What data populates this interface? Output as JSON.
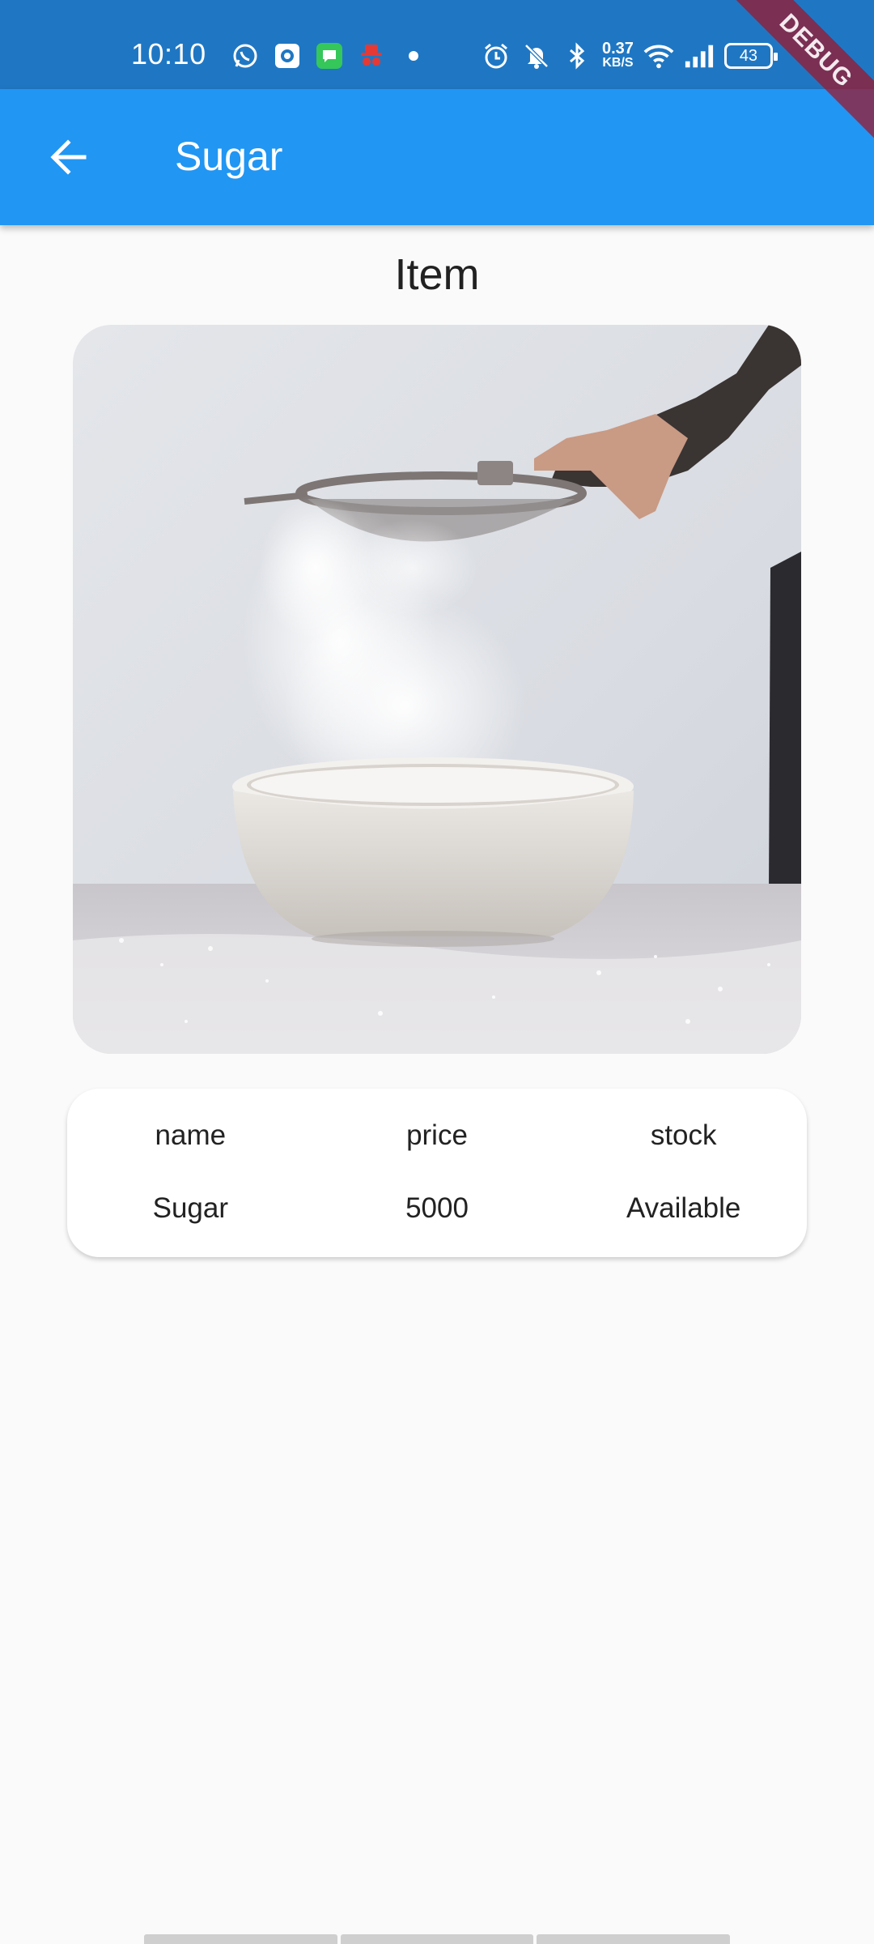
{
  "status_bar": {
    "time": "10:10",
    "net_speed_value": "0.37",
    "net_speed_unit": "KB/S",
    "battery": "43",
    "notification_icons": [
      "whatsapp-icon",
      "camera-app-icon",
      "messages-icon",
      "incognito-icon",
      "dot-icon"
    ],
    "system_icons": [
      "alarm-icon",
      "mute-icon",
      "bluetooth-icon",
      "wifi-icon",
      "signal-icon",
      "battery-icon"
    ]
  },
  "app_bar": {
    "title": "Sugar",
    "back_icon": "arrow-back-icon",
    "color": "#2196f3"
  },
  "debug_banner": "DEBUG",
  "content": {
    "heading": "Item",
    "image_subject": "sugar being sifted into a bowl",
    "table": {
      "headers": [
        "name",
        "price",
        "stock"
      ],
      "values": [
        "Sugar",
        "5000",
        "Available"
      ]
    }
  }
}
